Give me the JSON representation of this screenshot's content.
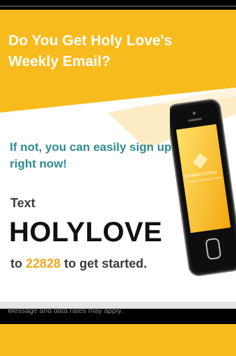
{
  "headline": "Do You Get Holy Love's Weekly Email?",
  "subheading": "If not, you can easily sign up right now!",
  "instructions": {
    "text_label": "Text",
    "keyword": "HOLYLOVE",
    "to_word": "to",
    "shortcode": "22828",
    "suffix": "to get started."
  },
  "disclaimer": "Message and data rates may apply.",
  "phone_logo": {
    "brand": "Constant Contact",
    "tagline": "Connect. Communicate. Achieve."
  },
  "colors": {
    "brand_yellow": "#f7bb1d",
    "teal_text": "#2f8b93",
    "shortcode_orange": "#f5a81d"
  }
}
